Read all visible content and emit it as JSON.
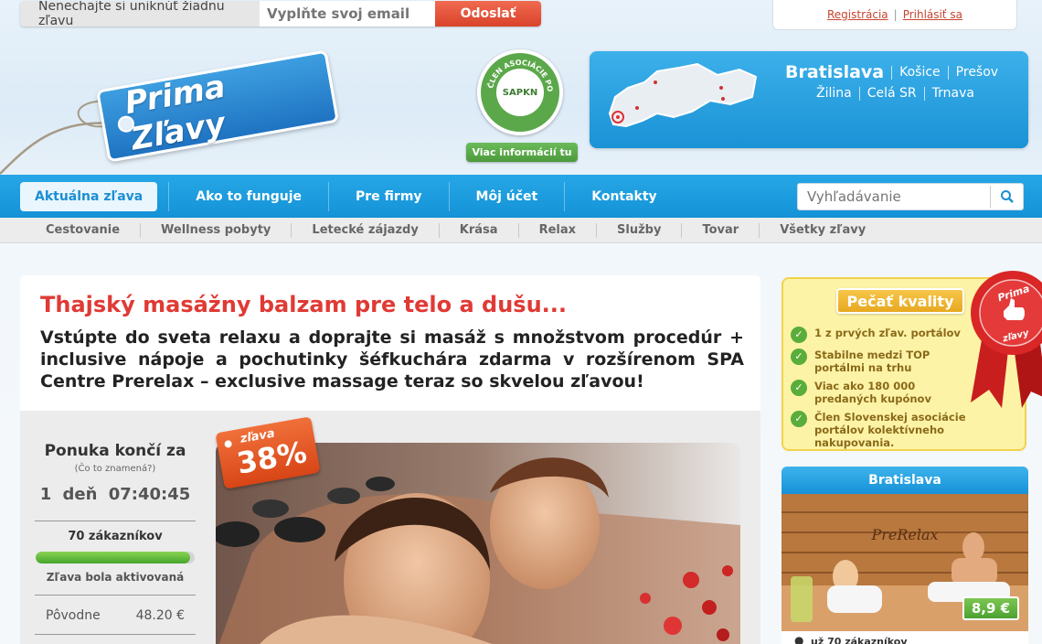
{
  "newsletter": {
    "label": "Nenechajte si uniknúť žiadnu zľavu",
    "email_placeholder": "Vyplňte svoj email",
    "submit_label": "Odoslať"
  },
  "account": {
    "register_label": "Registrácia",
    "login_label": "Prihlásiť sa"
  },
  "logo": {
    "text": "Prima Zľavy"
  },
  "badge": {
    "ring_text": "ČLEN ASOCIÁCIE PORTÁLOV",
    "center_text": "SAPKN",
    "button_label": "Viac informácií tu"
  },
  "cities": {
    "row1": [
      "Bratislava",
      "Košice",
      "Prešov"
    ],
    "row2": [
      "Žilina",
      "Celá SR",
      "Trnava"
    ]
  },
  "nav": {
    "items": [
      "Aktuálna zľava",
      "Ako to funguje",
      "Pre firmy",
      "Môj účet",
      "Kontakty"
    ],
    "search_placeholder": "Vyhľadávanie"
  },
  "subnav": {
    "items": [
      "Cestovanie",
      "Wellness pobyty",
      "Letecké zájazdy",
      "Krása",
      "Relax",
      "Služby",
      "Tovar",
      "Všetky zľavy"
    ]
  },
  "deal": {
    "title": "Thajský masážny balzam pre telo a dušu...",
    "description": "Vstúpte do sveta relaxu a doprajte si masáž s množstvom procedúr + inclusive nápoje a pochutinky šéfkuchára zdarma v rozšírenom SPA Centre Prerelax – exclusive massage teraz so skvelou zľavou!",
    "discount_label": "zľava",
    "discount_value": "38%",
    "counter_title": "Ponuka končí za",
    "counter_hint": "(Čo to znamená?)",
    "counter_time": "1 deň 07:40:45",
    "buyers": "70 zákazníkov",
    "progress": 0.97,
    "status": "Zľava bola aktivovaná",
    "price_label": "Pôvodne",
    "price_value": "48.20 €"
  },
  "quality": {
    "title": "Pečať kvality",
    "items": [
      "1 z prvých zľav. portálov",
      "Stabilne medzi TOP portálmi na trhu",
      "Viac ako 180 000 predaných kupónov",
      "Člen Slovenskej asociácie portálov kolektívneho nakupovania."
    ],
    "seal_text": "Prima zľavy"
  },
  "sidebox": {
    "title": "Bratislava",
    "image_caption": "PreRelax",
    "price": "8,9 €",
    "buyers": "už 70 zákazníkov"
  },
  "colors": {
    "brand_blue": "#1a92d6",
    "accent_red": "#e03a35",
    "success_green": "#5aad3a",
    "quality_yellow": "#fdf3a6"
  }
}
